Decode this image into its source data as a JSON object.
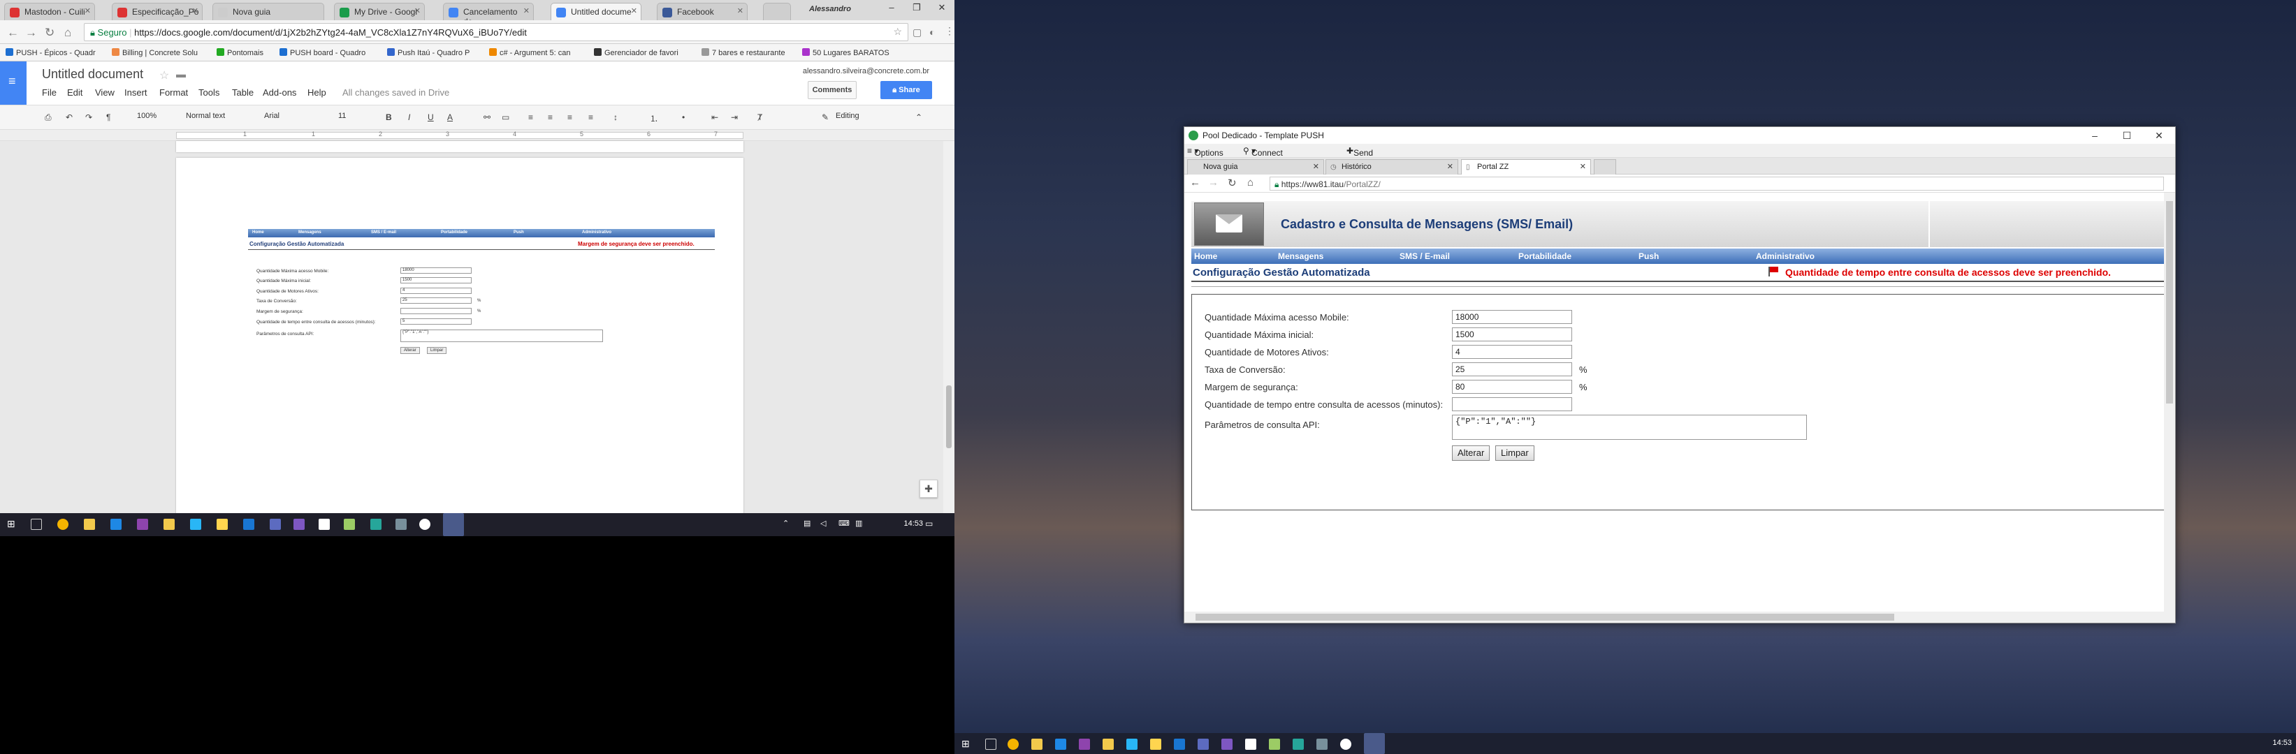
{
  "left": {
    "browser_tabs": [
      {
        "label": "Mastodon - Cuili",
        "color": "#d33"
      },
      {
        "label": "Especificação_Po",
        "color": "#d33"
      },
      {
        "label": "Nova guia",
        "color": "#ccc"
      },
      {
        "label": "My Drive - Googl",
        "color": "#1a9c4b"
      },
      {
        "label": "Cancelamento de",
        "color": "#4285f4"
      },
      {
        "label": "Untitled docume",
        "color": "#4285f4"
      },
      {
        "label": "Facebook",
        "color": "#3b5998"
      }
    ],
    "window_user": "Alessandro",
    "url_secure": "Seguro",
    "url": "https://docs.google.com/document/d/1jX2b2hZYtg24-4aM_VC8cXla1Z7nY4RQVuX6_iBUo7Y/edit",
    "bookmarks": [
      "PUSH - Épicos - Quadr",
      "Billing | Concrete Solu",
      "Pontomais",
      "PUSH board - Quadro",
      "Push Itaú - Quadro P",
      "c# - Argument 5: can",
      "Gerenciador de favori",
      "7 bares e restaurante",
      "50 Lugares BARATOS"
    ],
    "doc_title": "Untitled document",
    "menu": [
      "File",
      "Edit",
      "View",
      "Insert",
      "Format",
      "Tools",
      "Table",
      "Add-ons",
      "Help"
    ],
    "saved_status": "All changes saved in Drive",
    "user_email": "alessandro.silveira@concrete.com.br",
    "comments_label": "Comments",
    "share_label": "Share",
    "toolbar": {
      "zoom": "100%",
      "style": "Normal text",
      "font": "Arial",
      "size": "11",
      "mode": "Editing"
    },
    "ruler_marks": [
      "1",
      "1",
      "2",
      "3",
      "4",
      "5",
      "6",
      "7"
    ],
    "mini": {
      "nav": [
        "Home",
        "Mensagens",
        "SMS / E-mail",
        "Portabilidade",
        "Push",
        "Administrativo"
      ],
      "title": "Configuração Gestão Automatizada",
      "error": "Margem de segurança deve ser preenchido.",
      "fields": [
        {
          "label": "Quantidade Máxima acesso Mobile:",
          "value": "18000"
        },
        {
          "label": "Quantidade Máxima inicial:",
          "value": "1500"
        },
        {
          "label": "Quantidade de Motores Ativos:",
          "value": "4"
        },
        {
          "label": "Taxa de Conversão:",
          "value": "25"
        },
        {
          "label": "Margem de segurança:",
          "value": ""
        },
        {
          "label": "Quantidade de tempo entre consulta de acessos (minutos):",
          "value": "5"
        },
        {
          "label": "Parâmetros de consulta API:",
          "value": "{\"P\":\"1\",\"A\":\"\"}"
        }
      ],
      "pct": "%",
      "btn_alterar": "Alterar",
      "btn_limpar": "Limpar"
    },
    "clock": "14:53"
  },
  "right": {
    "rdp_title": "Pool Dedicado - Template PUSH",
    "rdp_menu": {
      "options": "Options",
      "usb": "Connect USB Device",
      "cad": "Send Ctrl-Alt-Delete"
    },
    "ie_tabs": [
      "Nova guia",
      "Histórico",
      "Portal ZZ"
    ],
    "ie_url_host": "https://ww81.itau",
    "ie_url_path": "/PortalZZ/",
    "banner_title": "Cadastro e Consulta de Mensagens (SMS/ Email)",
    "nav": [
      "Home",
      "Mensagens",
      "SMS / E-mail",
      "Portabilidade",
      "Push",
      "Administrativo"
    ],
    "page_title": "Configuração Gestão Automatizada",
    "error": "Quantidade de tempo entre consulta de acessos deve ser preenchido.",
    "fields": [
      {
        "label": "Quantidade Máxima acesso Mobile:",
        "value": "18000"
      },
      {
        "label": "Quantidade Máxima inicial:",
        "value": "1500"
      },
      {
        "label": "Quantidade de Motores Ativos:",
        "value": "4"
      },
      {
        "label": "Taxa de Conversão:",
        "value": "25"
      },
      {
        "label": "Margem de segurança:",
        "value": "80"
      },
      {
        "label": "Quantidade de tempo entre consulta de acessos (minutos):",
        "value": ""
      }
    ],
    "pct": "%",
    "api_label": "Parâmetros de consulta API:",
    "api_value": "{\"P\":\"1\",\"A\":\"\"}",
    "btn_alterar": "Alterar",
    "btn_limpar": "Limpar",
    "clock": "14:53"
  }
}
